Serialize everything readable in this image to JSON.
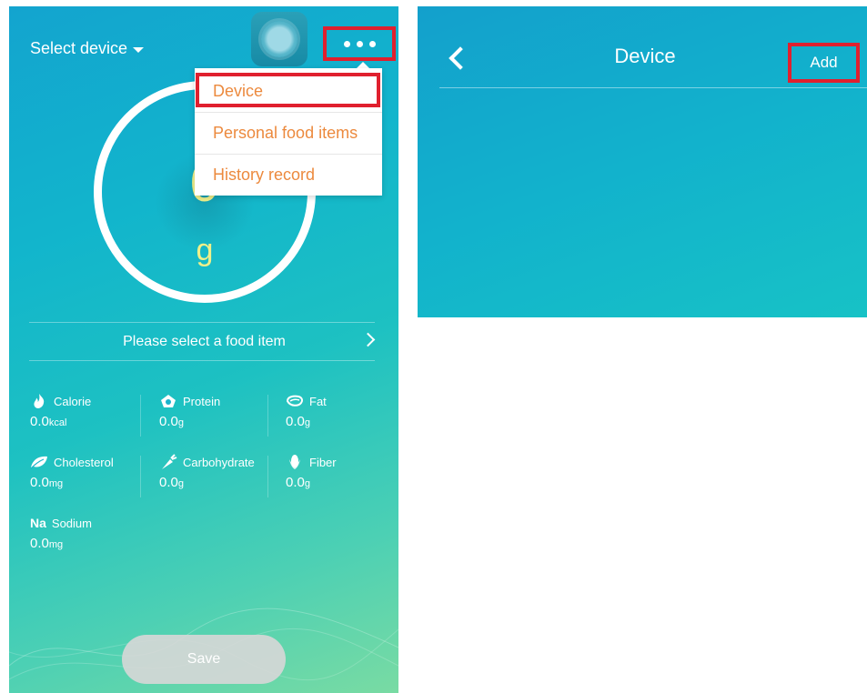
{
  "main_screen": {
    "select_device_label": "Select device",
    "more_menu": {
      "items": [
        {
          "label": "Device"
        },
        {
          "label": "Personal food items"
        },
        {
          "label": "History record"
        }
      ]
    },
    "gauge": {
      "value": "0",
      "unit": "g"
    },
    "food_selector": {
      "label": "Please select a food item"
    },
    "nutrients": [
      {
        "name": "Calorie",
        "icon": "flame-icon",
        "value": "0.0",
        "unit": "kcal"
      },
      {
        "name": "Protein",
        "icon": "egg-icon",
        "value": "0.0",
        "unit": "g"
      },
      {
        "name": "Fat",
        "icon": "fat-icon",
        "value": "0.0",
        "unit": "g"
      },
      {
        "name": "Cholesterol",
        "icon": "leaf-icon",
        "value": "0.0",
        "unit": "mg"
      },
      {
        "name": "Carbohydrate",
        "icon": "carrot-icon",
        "value": "0.0",
        "unit": "g"
      },
      {
        "name": "Fiber",
        "icon": "corn-icon",
        "value": "0.0",
        "unit": "g"
      },
      {
        "name": "Sodium",
        "icon": "na-icon",
        "icon_text": "Na",
        "value": "0.0",
        "unit": "mg"
      }
    ],
    "save_label": "Save"
  },
  "device_screen": {
    "title": "Device",
    "add_label": "Add"
  },
  "colors": {
    "highlight": "#e0202e",
    "menu_text": "#ec8a3e",
    "gauge_text": "#f0f08a"
  }
}
